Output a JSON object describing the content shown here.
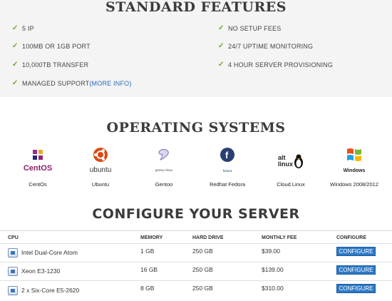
{
  "standard_features": {
    "title": "STANDARD FEATURES",
    "left": [
      "5 IP",
      "100MB OR 1GB PORT",
      "10,000TB TRANSFER",
      "MANAGED SUPPORT"
    ],
    "more_info": "(MORE INFO)",
    "right": [
      "NO SETUP FEES",
      "24/7 UPTIME MONITORING",
      "4 HOUR SERVER PROVISIONING"
    ]
  },
  "operating_systems": {
    "title": "OPERATING SYSTEMS",
    "items": [
      {
        "name": "CentOs",
        "logo_text": "CentOS",
        "icon": "centos-logo"
      },
      {
        "name": "Ubuntu",
        "logo_text": "ubuntu",
        "icon": "ubuntu-logo"
      },
      {
        "name": "Gentoo",
        "logo_text": "gentoo linux",
        "icon": "gentoo-logo"
      },
      {
        "name": "Redhat Fedora",
        "logo_text": "fedora",
        "icon": "fedora-logo"
      },
      {
        "name": "Cloud Linux",
        "logo_text": "alt linux",
        "icon": "cloudlinux-logo"
      },
      {
        "name": "Windows 2008/2012",
        "logo_text": "Windows",
        "icon": "windows-logo"
      }
    ]
  },
  "configure": {
    "title": "CONFIGURE YOUR SERVER",
    "headers": [
      "CPU",
      "MEMORY",
      "HARD DRIVE",
      "MONTHLY FEE",
      "CONFIGURE"
    ],
    "rows": [
      {
        "cpu": "Intel Dual-Core Atom",
        "memory": "1 GB",
        "drive": "250 GB",
        "fee": "$39.00",
        "button": "CONFIGURE"
      },
      {
        "cpu": "Xeon E3-1230",
        "memory": "16 GB",
        "drive": "250 GB",
        "fee": "$139.00",
        "button": "CONFIGURE"
      },
      {
        "cpu": "2 x Six-Core E5-2620",
        "memory": "8 GB",
        "drive": "250 GB",
        "fee": "$310.00",
        "button": "CONFIGURE"
      }
    ]
  },
  "colors": {
    "check": "#6aa52c",
    "button": "#2d79c6",
    "link": "#2a6bb8"
  }
}
